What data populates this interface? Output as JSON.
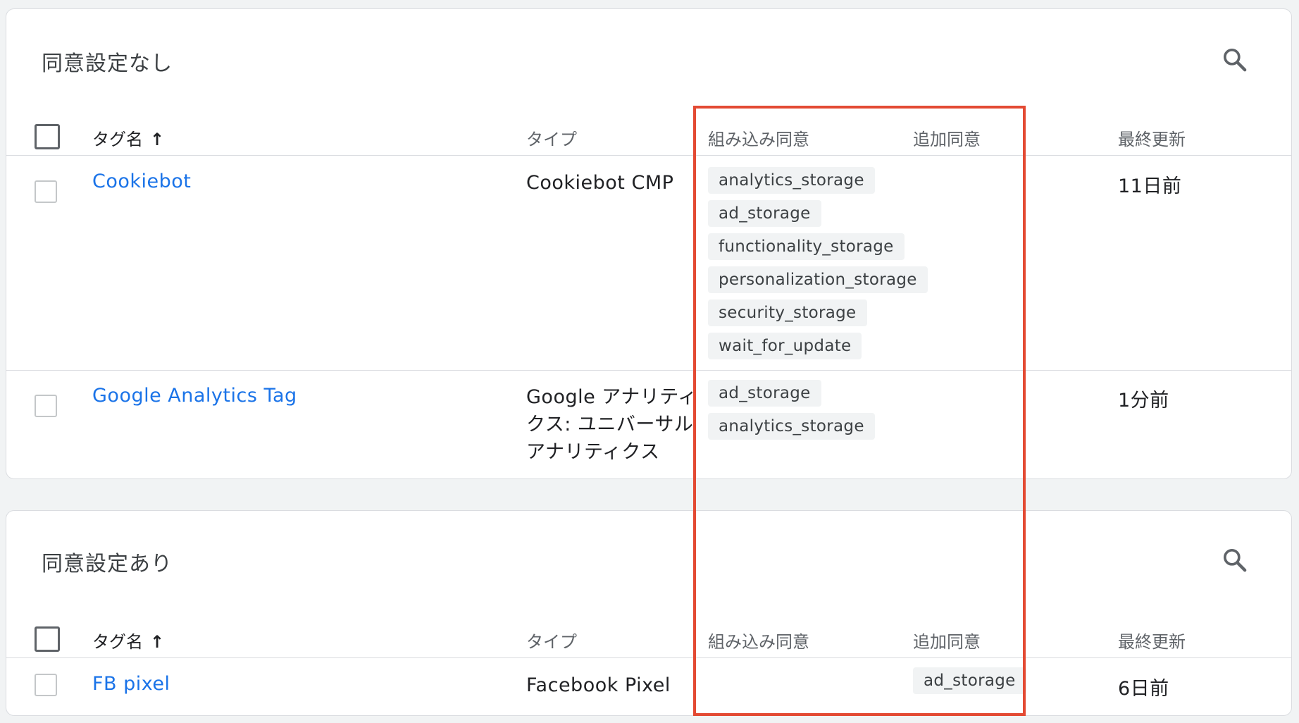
{
  "sections": [
    {
      "title": "同意設定なし",
      "columns": {
        "name": "タグ名",
        "type": "タイプ",
        "builtin_consent": "組み込み同意",
        "additional_consent": "追加同意",
        "last_updated": "最終更新"
      },
      "rows": [
        {
          "name": "Cookiebot",
          "type": "Cookiebot CMP",
          "builtin": [
            "analytics_storage",
            "ad_storage",
            "functionality_storage",
            "personalization_storage",
            "security_storage",
            "wait_for_update"
          ],
          "additional": [],
          "updated": "11日前"
        },
        {
          "name": "Google Analytics Tag",
          "type": "Google アナリティクス: ユニバーサル アナリティクス",
          "builtin": [
            "ad_storage",
            "analytics_storage"
          ],
          "additional": [],
          "updated": "1分前"
        }
      ]
    },
    {
      "title": "同意設定あり",
      "columns": {
        "name": "タグ名",
        "type": "タイプ",
        "builtin_consent": "組み込み同意",
        "additional_consent": "追加同意",
        "last_updated": "最終更新"
      },
      "rows": [
        {
          "name": "FB pixel",
          "type": "Facebook Pixel",
          "builtin": [],
          "additional": [
            "ad_storage"
          ],
          "updated": "6日前"
        }
      ]
    }
  ],
  "icons": {
    "search": "search-icon",
    "sort": "arrow-up-icon"
  },
  "colors": {
    "link": "#1a73e8",
    "highlight": "#e34a33",
    "chip_bg": "#f1f3f4"
  }
}
